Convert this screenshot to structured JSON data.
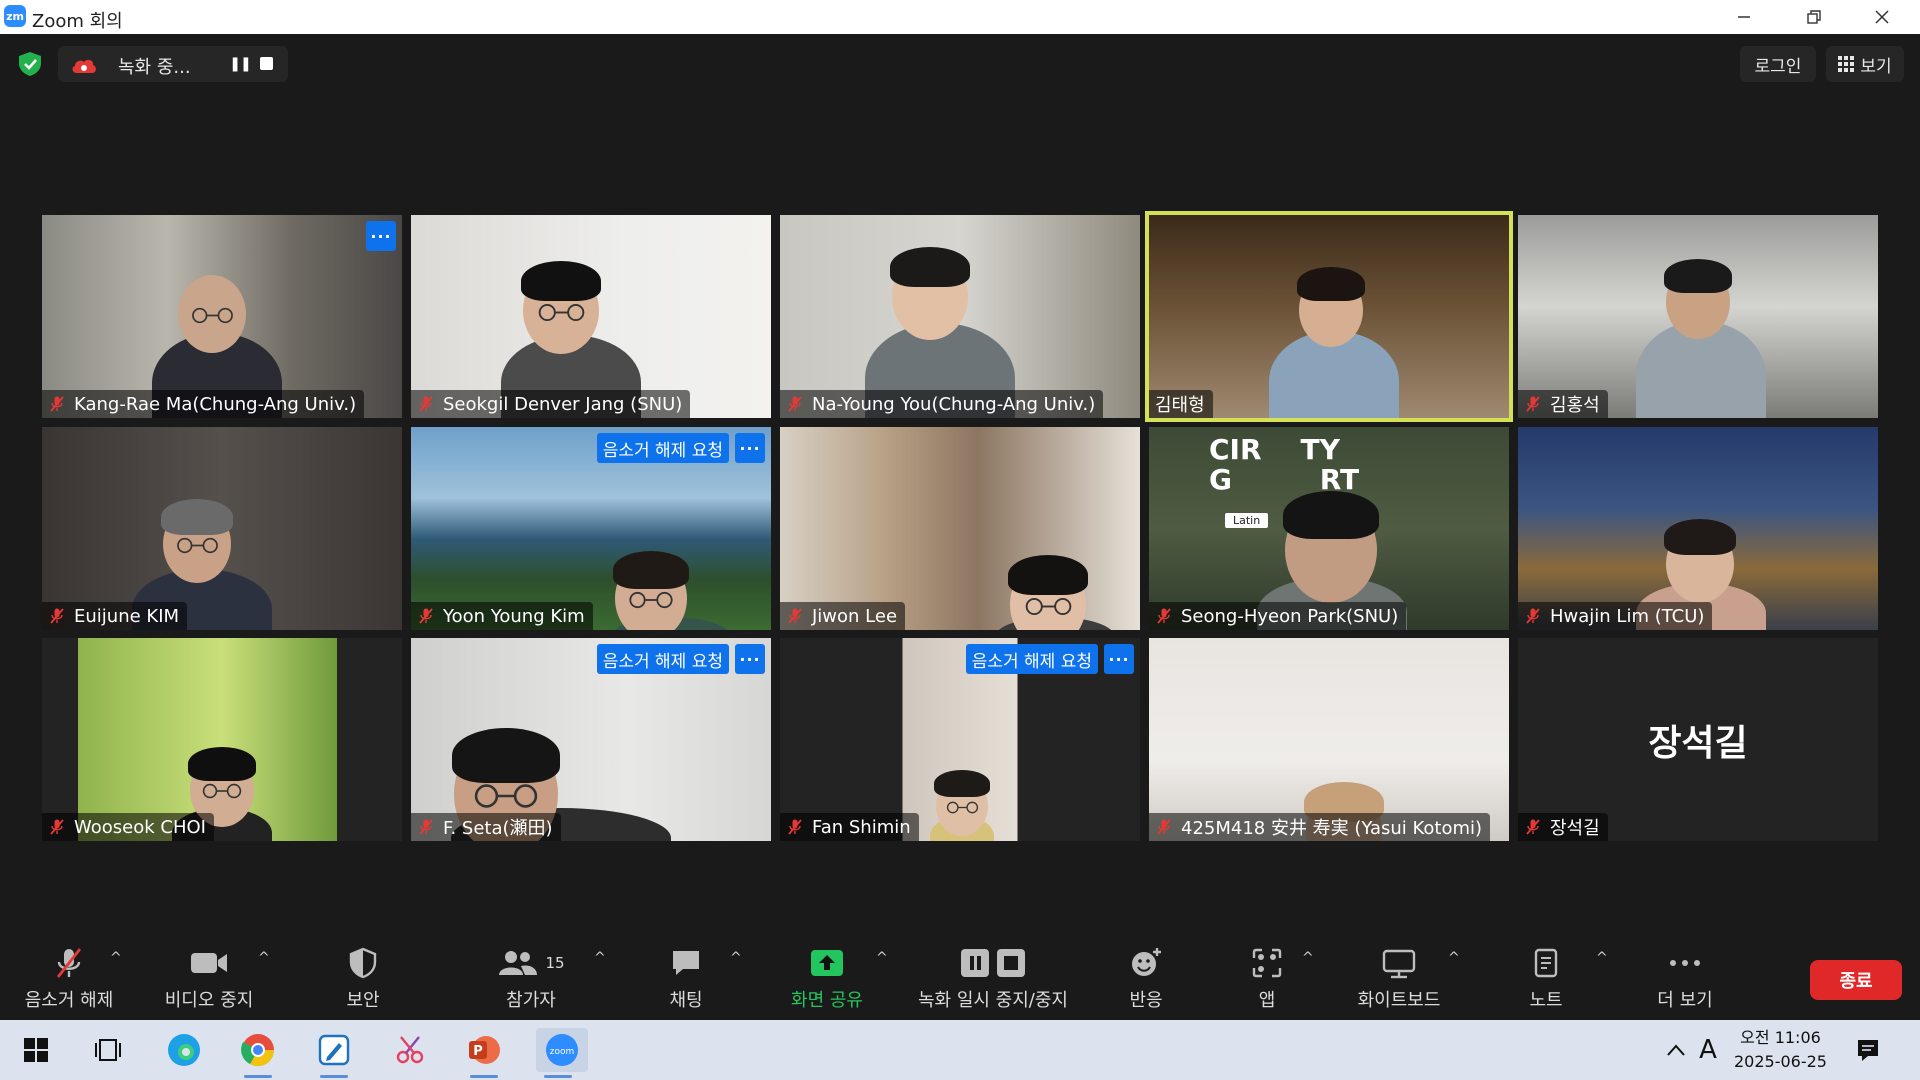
{
  "window": {
    "title": "Zoom 회의",
    "logo_text": "zm"
  },
  "recording": {
    "status": "녹화 중..."
  },
  "top_right": {
    "login": "로그인",
    "view": "보기"
  },
  "unmute_request_label": "음소거 해제 요청",
  "more_label": "···",
  "participants": [
    {
      "name": "Kang-Rae Ma(Chung-Ang Univ.)",
      "muted": true,
      "more_badge": true
    },
    {
      "name": "Seokgil Denver Jang (SNU)",
      "muted": true
    },
    {
      "name": "Na-Young You(Chung-Ang Univ.)",
      "muted": true
    },
    {
      "name": "김태형",
      "muted": false,
      "active_speaker": true
    },
    {
      "name": "김홍석",
      "muted": true
    },
    {
      "name": "Euijune KIM",
      "muted": true
    },
    {
      "name": "Yoon Young Kim",
      "muted": true,
      "unmute_request": true
    },
    {
      "name": "Jiwon Lee",
      "muted": true
    },
    {
      "name": "Seong-Hyeon Park(SNU)",
      "muted": true,
      "bg_text": "CIR    TY\nG         RT",
      "bg_small": "Latin"
    },
    {
      "name": "Hwajin Lim (TCU)",
      "muted": true
    },
    {
      "name": "Wooseok CHOI",
      "muted": true
    },
    {
      "name": "F. Seta(瀬田)",
      "muted": true,
      "unmute_request": true
    },
    {
      "name": "Fan Shimin",
      "muted": true,
      "unmute_request": true
    },
    {
      "name": "425M418 安井 寿実 (Yasui Kotomi)",
      "muted": true
    },
    {
      "name": "장석길",
      "muted": true,
      "video_off": true,
      "display_name": "장석길"
    }
  ],
  "toolbar": {
    "unmute": "음소거 해제",
    "stop_video": "비디오 중지",
    "security": "보안",
    "participants": "참가자",
    "participant_count": "15",
    "chat": "채팅",
    "share_screen": "화면 공유",
    "recording_controls": "녹화 일시 중지/중지",
    "reactions": "반응",
    "apps": "앱",
    "whiteboard": "화이트보드",
    "notes": "노트",
    "more": "더 보기",
    "end": "종료"
  },
  "taskbar": {
    "time": "오전 11:06",
    "date": "2025-06-25",
    "ime": "A"
  },
  "colors": {
    "accent_blue": "#0e72ed",
    "end_red": "#e02828",
    "active_outline": "#d4e157",
    "share_green": "#22c55e"
  }
}
